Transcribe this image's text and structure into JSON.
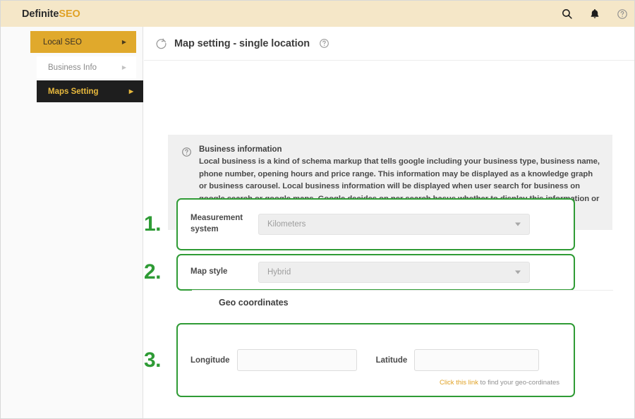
{
  "brand": {
    "part1": "Definite",
    "part2": "SEO"
  },
  "topbar": {
    "icons": [
      {
        "name": "search-icon",
        "label": "Search"
      },
      {
        "name": "notification-bell-icon",
        "label": "Notifications"
      },
      {
        "name": "help-circle-icon",
        "label": "Help"
      }
    ]
  },
  "sidebar": {
    "items": [
      {
        "label": "Local SEO",
        "arrow": "▶",
        "level": 1
      },
      {
        "label": "Business Info",
        "arrow": "▶",
        "level": 2
      },
      {
        "label": "Maps Setting",
        "arrow": "▶",
        "level": 3
      }
    ]
  },
  "page": {
    "title": "Map setting - single location",
    "title_icon": "refresh-circle-icon",
    "help_icon": "help-circle-icon"
  },
  "info_panel": {
    "icon": "help-circle-icon",
    "title": "Business information",
    "text": "Local business is a kind of schema markup that tells google including your business type, business name, phone number, opening hours and price range. This information may be displayed as a knowledge graph or business carousel. Local business information will be displayed when user search for business on google search or google maps. Google decides on per search basus whether to display this information or not its completely automated."
  },
  "steps": [
    {
      "number": "1.",
      "field_label": "Measurement system",
      "control": "select",
      "value": "Kilometers"
    },
    {
      "number": "2.",
      "field_label": "Map style",
      "control": "select",
      "value": "Hybrid"
    },
    {
      "number": "3.",
      "control": "coordinates"
    }
  ],
  "geo": {
    "heading": "Geo coordinates",
    "longitude_label": "Longitude",
    "longitude_value": "",
    "longitude_placeholder": "",
    "latitude_label": "Latitude",
    "latitude_value": "",
    "latitude_placeholder": "",
    "link_text": "Click this link",
    "link_suffix": " to find your geo-cordinates"
  },
  "colors": {
    "brand_gold": "#e0a226",
    "topbar_bg": "#f5e7c8",
    "nav_active": "#e0a92c",
    "nav_selected_bg": "#1e1e1e",
    "nav_selected_text": "#e8b93d",
    "highlight_green": "#2f9b35",
    "info_bg": "#f0f0f0"
  }
}
